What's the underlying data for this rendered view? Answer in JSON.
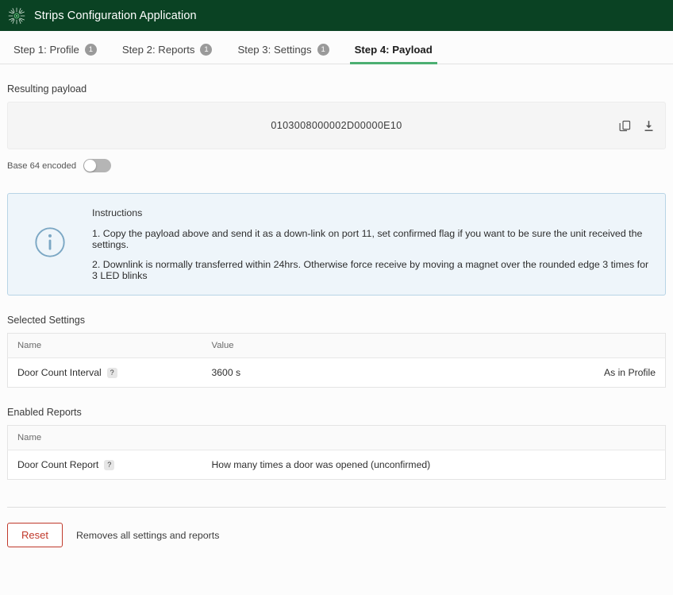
{
  "header": {
    "title": "Strips Configuration Application",
    "logo_icon": "sunburst-logo-icon",
    "background_color": "#0a4223"
  },
  "tabs": {
    "accent_color": "#4caf72",
    "items": [
      {
        "label": "Step 1: Profile",
        "badge": "1",
        "active": false
      },
      {
        "label": "Step 2: Reports",
        "badge": "1",
        "active": false
      },
      {
        "label": "Step 3: Settings",
        "badge": "1",
        "active": false
      },
      {
        "label": "Step 4: Payload",
        "badge": "",
        "active": true
      }
    ]
  },
  "payload": {
    "section_label": "Resulting payload",
    "value": "0103008000002D00000E10",
    "copy_icon": "copy-icon",
    "download_icon": "download-icon",
    "toggle_label": "Base 64 encoded",
    "toggle_state": "off"
  },
  "instructions": {
    "icon": "info-circle-icon",
    "title": "Instructions",
    "lines": [
      "1. Copy the payload above and send it as a down-link on port 11, set confirmed flag if you want to be sure the unit received the settings.",
      "2. Downlink is normally transferred within 24hrs. Otherwise force receive by moving a magnet over the rounded edge 3 times for 3 LED blinks"
    ],
    "background_color": "#eef5fa",
    "border_color": "#b8d4e6"
  },
  "selected_settings": {
    "section_label": "Selected Settings",
    "columns": [
      "Name",
      "Value",
      ""
    ],
    "rows": [
      {
        "name": "Door Count Interval",
        "help": "?",
        "value": "3600 s",
        "note": "As in Profile"
      }
    ]
  },
  "enabled_reports": {
    "section_label": "Enabled Reports",
    "columns": [
      "Name",
      ""
    ],
    "rows": [
      {
        "name": "Door Count Report",
        "help": "?",
        "description": "How many times a door was opened (unconfirmed)"
      }
    ]
  },
  "footer": {
    "reset_label": "Reset",
    "reset_color": "#c0392b",
    "note": "Removes all settings and reports"
  }
}
